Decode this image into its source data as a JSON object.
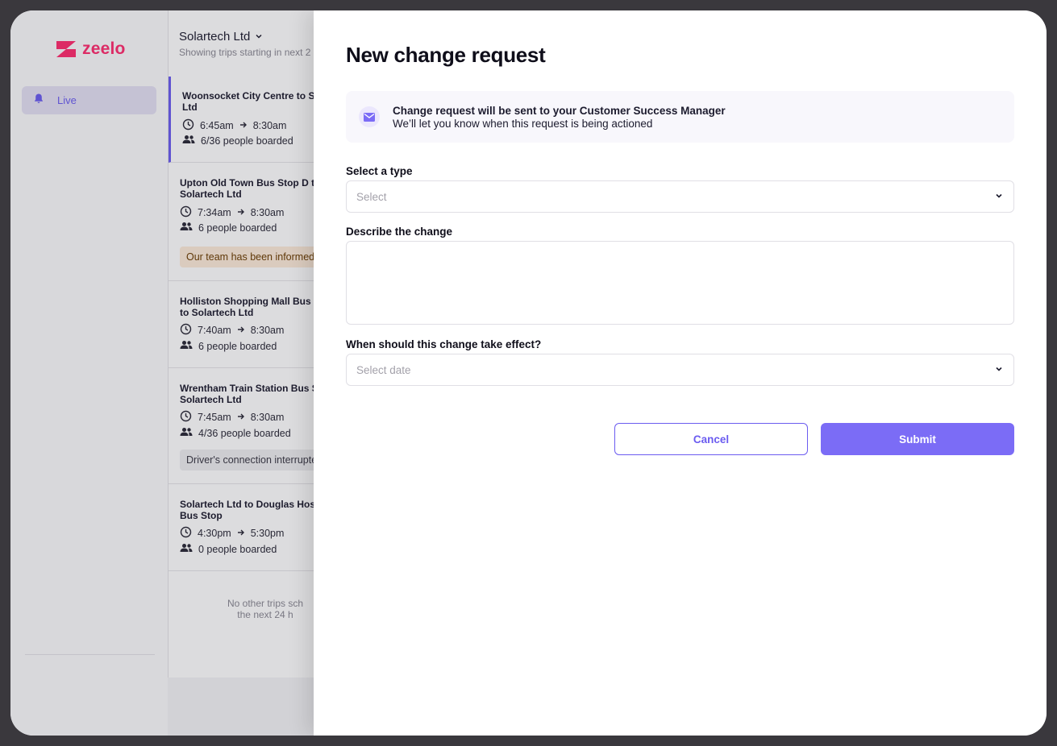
{
  "colors": {
    "brand": "#ff2d6f",
    "accent": "#6b5cf0",
    "submit": "#7b6cf6",
    "warn_badge": "#fdebd9"
  },
  "app": {
    "logo_text": "zeelo",
    "nav": [
      {
        "label": "Live",
        "icon": "bell-icon",
        "active": true
      }
    ]
  },
  "trips_panel": {
    "company": "Solartech Ltd",
    "subtitle": "Showing trips starting in next 2",
    "trips": [
      {
        "title_line1": "Woonsocket City Centre to So",
        "title_line2": "Ltd",
        "time_start": "6:45am",
        "time_end": "8:30am",
        "boarded": "6/36 people boarded",
        "active": true,
        "badge": ""
      },
      {
        "title_line1": "Upton Old Town Bus Stop D to",
        "title_line2": "Solartech Ltd",
        "time_start": "7:34am",
        "time_end": "8:30am",
        "boarded": "6 people boarded",
        "badge": "Our team has been informed"
      },
      {
        "title_line1": "Holliston Shopping Mall Bus S",
        "title_line2": "to Solartech Ltd",
        "time_start": "7:40am",
        "time_end": "8:30am",
        "boarded": "6 people boarded",
        "badge": ""
      },
      {
        "title_line1": "Wrentham Train Station Bus S",
        "title_line2": "Solartech Ltd",
        "time_start": "7:45am",
        "time_end": "8:30am",
        "boarded": "4/36 people boarded",
        "badge": "Driver's connection interrupte"
      },
      {
        "title_line1": "Solartech Ltd to Douglas Hosp",
        "title_line2": "Bus Stop",
        "time_start": "4:30pm",
        "time_end": "5:30pm",
        "boarded": "0 people boarded",
        "badge": ""
      }
    ],
    "empty_line1": "No other trips sch",
    "empty_line2": "the next 24 h"
  },
  "modal": {
    "title": "New change request",
    "info_title": "Change request will be sent to your Customer Success Manager",
    "info_sub": "We’ll let you know when this request is being actioned",
    "type_label": "Select a type",
    "type_placeholder": "Select",
    "describe_label": "Describe the change",
    "describe_value": "",
    "effect_label": "When should this change take effect?",
    "effect_placeholder": "Select date",
    "cancel_label": "Cancel",
    "submit_label": "Submit"
  }
}
